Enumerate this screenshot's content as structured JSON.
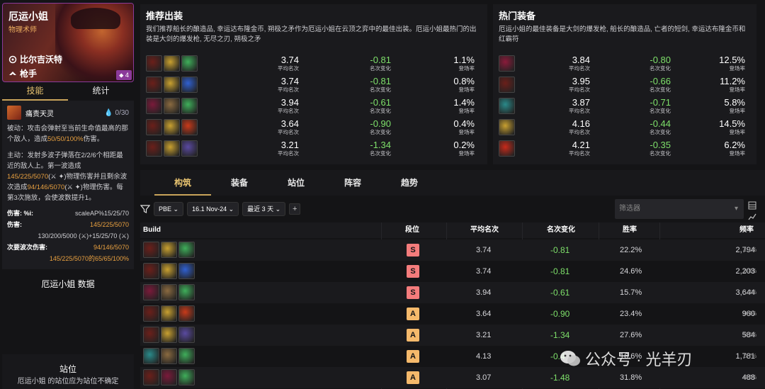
{
  "champion": {
    "name": "厄运小姐",
    "role": "物理术师",
    "traits": [
      "比尔吉沃特",
      "枪手"
    ],
    "cost": "4"
  },
  "left_tabs": [
    "技能",
    "统计"
  ],
  "skill": {
    "name": "痛责天灵",
    "mana": "0/30",
    "passive_a": "被动：攻击会弹射至当前生命值最高的那个敌人，造成",
    "passive_b": "50/50/100%",
    "passive_c": "伤害。",
    "active_a": "主动：发射多波子弹落在2/2/6个相距最近的敌人上。第一波造成",
    "active_b": "145/225/5070",
    "active_c": "物理伤害并且剩余波次造成",
    "active_d": "94/146/5070",
    "active_e": "物理伤害。每第3次施放，会使波数提升1。",
    "stats": [
      {
        "label": "伤害: %i:",
        "value": "scaleAP%15/25/70"
      },
      {
        "label": "伤害:",
        "value": "145/225/5070"
      },
      {
        "label": "",
        "value": "130/200/5000 (⚔)+15/25/70 (⚔)"
      },
      {
        "label": "次要波次伤害:",
        "value": "94/146/5070"
      },
      {
        "label": "",
        "value": "145/225/5070的65/65/100%"
      }
    ]
  },
  "data_title": "厄运小姐 数据",
  "position": {
    "title": "站位",
    "note": "厄运小姐 的站位应为站位不确定"
  },
  "recommended": {
    "title": "推荐出装",
    "desc": "我们推荐船长的酿造品, 幸运达布隆金币, 朔极之矛作为厄运小姐在云顶之弈中的最佳出装。厄运小姐最热门的出装是大剑的爆发枪, 无尽之刃, 朔极之矛",
    "rows": [
      {
        "avg": "3.74",
        "avg_l": "平均名次",
        "chg": "-0.81",
        "chg_l": "名次变化",
        "rate": "1.1%",
        "rate_l": "登场率"
      },
      {
        "avg": "3.74",
        "avg_l": "平均名次",
        "chg": "-0.81",
        "chg_l": "名次变化",
        "rate": "0.8%",
        "rate_l": "登场率"
      },
      {
        "avg": "3.94",
        "avg_l": "平均名次",
        "chg": "-0.61",
        "chg_l": "名次变化",
        "rate": "1.4%",
        "rate_l": "登场率"
      },
      {
        "avg": "3.64",
        "avg_l": "平均名次",
        "chg": "-0.90",
        "chg_l": "名次变化",
        "rate": "0.4%",
        "rate_l": "登场率"
      },
      {
        "avg": "3.21",
        "avg_l": "平均名次",
        "chg": "-1.34",
        "chg_l": "名次变化",
        "rate": "0.2%",
        "rate_l": "登场率"
      }
    ]
  },
  "hot": {
    "title": "热门装备",
    "desc": "厄运小姐的最佳装备是大剑的爆发枪, 船长的酿造品, 亡者的短剑, 幸运达布隆金币和红霸符",
    "rows": [
      {
        "avg": "3.84",
        "avg_l": "平均名次",
        "chg": "-0.80",
        "chg_l": "名次变化",
        "rate": "12.5%",
        "rate_l": "登场率"
      },
      {
        "avg": "3.95",
        "avg_l": "平均名次",
        "chg": "-0.66",
        "chg_l": "名次变化",
        "rate": "11.2%",
        "rate_l": "登场率"
      },
      {
        "avg": "3.87",
        "avg_l": "平均名次",
        "chg": "-0.71",
        "chg_l": "名次变化",
        "rate": "5.8%",
        "rate_l": "登场率"
      },
      {
        "avg": "4.16",
        "avg_l": "平均名次",
        "chg": "-0.44",
        "chg_l": "名次变化",
        "rate": "14.5%",
        "rate_l": "登场率"
      },
      {
        "avg": "4.21",
        "avg_l": "平均名次",
        "chg": "-0.35",
        "chg_l": "名次变化",
        "rate": "6.2%",
        "rate_l": "登场率"
      }
    ]
  },
  "main_tabs": [
    "构筑",
    "装备",
    "站位",
    "阵容",
    "趋势"
  ],
  "filters": {
    "server": "PBE",
    "patch": "16.1 Nov-24",
    "range": "最近 3 天",
    "search_placeholder": "筛选器"
  },
  "table": {
    "headers": [
      "Build",
      "段位",
      "平均名次",
      "名次变化",
      "胜率",
      "频率"
    ],
    "rows": [
      {
        "tier": "S",
        "avg": "3.74",
        "chg": "-0.81",
        "win": "22.2%",
        "freq": "2,794",
        "freq_pct": "1.1%"
      },
      {
        "tier": "S",
        "avg": "3.74",
        "chg": "-0.81",
        "win": "24.6%",
        "freq": "2,203",
        "freq_pct": "0.8%"
      },
      {
        "tier": "S",
        "avg": "3.94",
        "chg": "-0.61",
        "win": "15.7%",
        "freq": "3,644",
        "freq_pct": "1.4%"
      },
      {
        "tier": "A",
        "avg": "3.64",
        "chg": "-0.90",
        "win": "23.4%",
        "freq": "960",
        "freq_pct": "0.4%"
      },
      {
        "tier": "A",
        "avg": "3.21",
        "chg": "-1.34",
        "win": "27.6%",
        "freq": "584",
        "freq_pct": "0.2%"
      },
      {
        "tier": "A",
        "avg": "4.13",
        "chg": "-0.4",
        "win": "16.6%",
        "freq": "1,781",
        "freq_pct": "0.7%"
      },
      {
        "tier": "A",
        "avg": "3.07",
        "chg": "-1.48",
        "win": "31.8%",
        "freq": "488",
        "freq_pct": "0.2%"
      }
    ]
  },
  "watermark": "公众号 · 光羊刃",
  "colors": {
    "accent_gold": "#c9a45a",
    "tier_s": "#f47c7c",
    "tier_a": "#f5b96b",
    "positive_green": "#7ee06a",
    "card_border": "#8b3a9a"
  }
}
